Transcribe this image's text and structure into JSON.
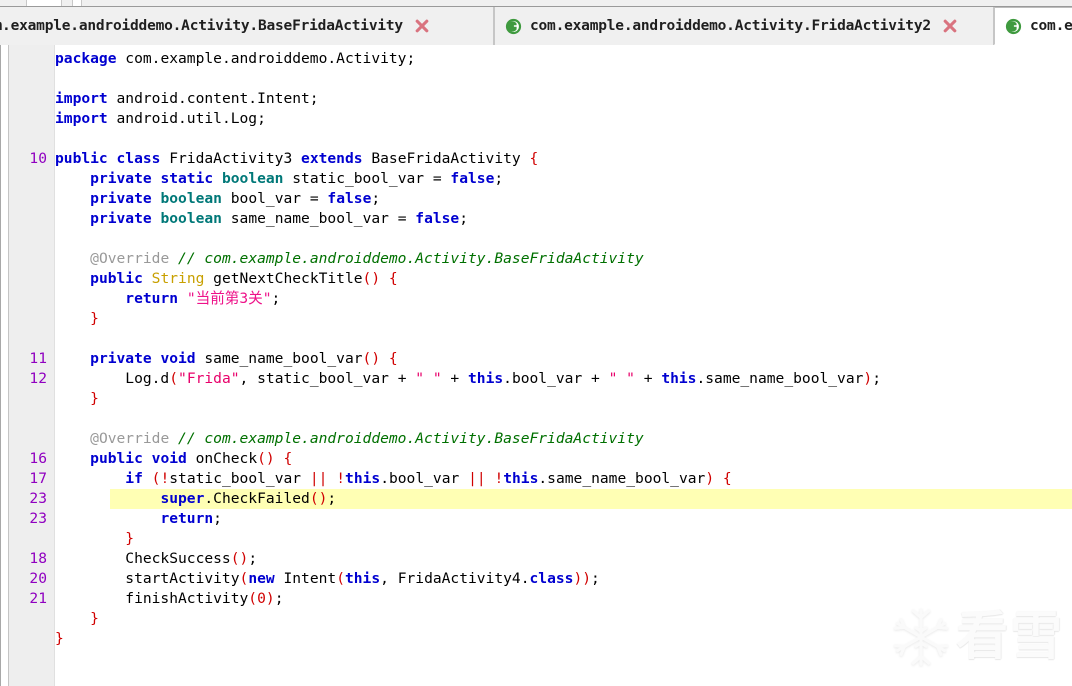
{
  "window": {
    "app": "jadx-gui",
    "theme_bg": "#ffffff",
    "gutter_bg": "#eeeeee",
    "highlight_color": "#ffffb4",
    "lineno_color": "#9000c0"
  },
  "tabs": [
    {
      "id": "tab-0",
      "label": "om.example.androiddemo.Activity.BaseFridaActivity",
      "icon": "class-icon",
      "close_icon": "close-x-icon",
      "active": false,
      "truncated_left": true
    },
    {
      "id": "tab-1",
      "label": "com.example.androiddemo.Activity.FridaActivity2",
      "icon": "class-icon",
      "close_icon": "close-x-icon",
      "active": false,
      "truncated_left": false
    },
    {
      "id": "tab-2",
      "label": "com.e",
      "icon": "class-icon",
      "close_icon": null,
      "active": true,
      "truncated_left": false
    }
  ],
  "editor": {
    "language": "java",
    "highlighted_line_index": 22,
    "lines": [
      {
        "no": "",
        "tokens": [
          {
            "c": "k",
            "t": "package"
          },
          {
            "c": "n",
            "t": " com.example.androiddemo.Activity;"
          }
        ]
      },
      {
        "no": "",
        "tokens": []
      },
      {
        "no": "",
        "tokens": [
          {
            "c": "k",
            "t": "import"
          },
          {
            "c": "n",
            "t": " android.content.Intent;"
          }
        ]
      },
      {
        "no": "",
        "tokens": [
          {
            "c": "k",
            "t": "import"
          },
          {
            "c": "n",
            "t": " android.util.Log;"
          }
        ]
      },
      {
        "no": "",
        "tokens": []
      },
      {
        "no": "10",
        "tokens": [
          {
            "c": "k",
            "t": "public class"
          },
          {
            "c": "n",
            "t": " FridaActivity3 "
          },
          {
            "c": "k",
            "t": "extends"
          },
          {
            "c": "n",
            "t": " BaseFridaActivity "
          },
          {
            "c": "p",
            "t": "{"
          }
        ]
      },
      {
        "no": "",
        "tokens": [
          {
            "c": "n",
            "t": "    "
          },
          {
            "c": "k",
            "t": "private static"
          },
          {
            "c": "n",
            "t": " "
          },
          {
            "c": "t",
            "t": "boolean"
          },
          {
            "c": "n",
            "t": " static_bool_var = "
          },
          {
            "c": "k",
            "t": "false"
          },
          {
            "c": "n",
            "t": ";"
          }
        ]
      },
      {
        "no": "",
        "tokens": [
          {
            "c": "n",
            "t": "    "
          },
          {
            "c": "k",
            "t": "private"
          },
          {
            "c": "n",
            "t": " "
          },
          {
            "c": "t",
            "t": "boolean"
          },
          {
            "c": "n",
            "t": " bool_var = "
          },
          {
            "c": "k",
            "t": "false"
          },
          {
            "c": "n",
            "t": ";"
          }
        ]
      },
      {
        "no": "",
        "tokens": [
          {
            "c": "n",
            "t": "    "
          },
          {
            "c": "k",
            "t": "private"
          },
          {
            "c": "n",
            "t": " "
          },
          {
            "c": "t",
            "t": "boolean"
          },
          {
            "c": "n",
            "t": " same_name_bool_var = "
          },
          {
            "c": "k",
            "t": "false"
          },
          {
            "c": "n",
            "t": ";"
          }
        ]
      },
      {
        "no": "",
        "tokens": []
      },
      {
        "no": "",
        "tokens": [
          {
            "c": "n",
            "t": "    "
          },
          {
            "c": "an",
            "t": "@Override"
          },
          {
            "c": "n",
            "t": " "
          },
          {
            "c": "c",
            "t": "// com.example.androiddemo.Activity.BaseFridaActivity"
          }
        ]
      },
      {
        "no": "",
        "tokens": [
          {
            "c": "n",
            "t": "    "
          },
          {
            "c": "k",
            "t": "public"
          },
          {
            "c": "n",
            "t": " "
          },
          {
            "c": "ty",
            "t": "String"
          },
          {
            "c": "n",
            "t": " getNextCheckTitle"
          },
          {
            "c": "p",
            "t": "()"
          },
          {
            "c": "n",
            "t": " "
          },
          {
            "c": "p",
            "t": "{"
          }
        ]
      },
      {
        "no": "",
        "tokens": [
          {
            "c": "n",
            "t": "        "
          },
          {
            "c": "k",
            "t": "return"
          },
          {
            "c": "n",
            "t": " "
          },
          {
            "c": "s",
            "t": "\"当前第3关\""
          },
          {
            "c": "n",
            "t": ";"
          }
        ]
      },
      {
        "no": "",
        "tokens": [
          {
            "c": "n",
            "t": "    "
          },
          {
            "c": "p",
            "t": "}"
          }
        ]
      },
      {
        "no": "",
        "tokens": []
      },
      {
        "no": "11",
        "tokens": [
          {
            "c": "n",
            "t": "    "
          },
          {
            "c": "k",
            "t": "private void"
          },
          {
            "c": "n",
            "t": " same_name_bool_var"
          },
          {
            "c": "p",
            "t": "()"
          },
          {
            "c": "n",
            "t": " "
          },
          {
            "c": "p",
            "t": "{"
          }
        ]
      },
      {
        "no": "12",
        "tokens": [
          {
            "c": "n",
            "t": "        Log.d"
          },
          {
            "c": "p",
            "t": "("
          },
          {
            "c": "str",
            "t": "\"Frida\""
          },
          {
            "c": "n",
            "t": ", static_bool_var + "
          },
          {
            "c": "str",
            "t": "\" \""
          },
          {
            "c": "n",
            "t": " + "
          },
          {
            "c": "k",
            "t": "this"
          },
          {
            "c": "n",
            "t": ".bool_var + "
          },
          {
            "c": "str",
            "t": "\" \""
          },
          {
            "c": "n",
            "t": " + "
          },
          {
            "c": "k",
            "t": "this"
          },
          {
            "c": "n",
            "t": ".same_name_bool_var"
          },
          {
            "c": "p",
            "t": ")"
          },
          {
            "c": "n",
            "t": ";"
          }
        ]
      },
      {
        "no": "",
        "tokens": [
          {
            "c": "n",
            "t": "    "
          },
          {
            "c": "p",
            "t": "}"
          }
        ]
      },
      {
        "no": "",
        "tokens": []
      },
      {
        "no": "",
        "tokens": [
          {
            "c": "n",
            "t": "    "
          },
          {
            "c": "an",
            "t": "@Override"
          },
          {
            "c": "n",
            "t": " "
          },
          {
            "c": "c",
            "t": "// com.example.androiddemo.Activity.BaseFridaActivity"
          }
        ]
      },
      {
        "no": "16",
        "tokens": [
          {
            "c": "n",
            "t": "    "
          },
          {
            "c": "k",
            "t": "public void"
          },
          {
            "c": "n",
            "t": " onCheck"
          },
          {
            "c": "p",
            "t": "()"
          },
          {
            "c": "n",
            "t": " "
          },
          {
            "c": "p",
            "t": "{"
          }
        ]
      },
      {
        "no": "17",
        "tokens": [
          {
            "c": "n",
            "t": "        "
          },
          {
            "c": "k",
            "t": "if"
          },
          {
            "c": "n",
            "t": " "
          },
          {
            "c": "p",
            "t": "("
          },
          {
            "c": "p",
            "t": "!"
          },
          {
            "c": "n",
            "t": "static_bool_var "
          },
          {
            "c": "p",
            "t": "||"
          },
          {
            "c": "n",
            "t": " "
          },
          {
            "c": "p",
            "t": "!"
          },
          {
            "c": "k",
            "t": "this"
          },
          {
            "c": "n",
            "t": ".bool_var "
          },
          {
            "c": "p",
            "t": "||"
          },
          {
            "c": "n",
            "t": " "
          },
          {
            "c": "p",
            "t": "!"
          },
          {
            "c": "k",
            "t": "this"
          },
          {
            "c": "n",
            "t": ".same_name_bool_var"
          },
          {
            "c": "p",
            "t": ")"
          },
          {
            "c": "n",
            "t": " "
          },
          {
            "c": "p",
            "t": "{"
          }
        ]
      },
      {
        "no": "23",
        "tokens": [
          {
            "c": "n",
            "t": "            "
          },
          {
            "c": "k",
            "t": "super"
          },
          {
            "c": "n",
            "t": ".CheckFailed"
          },
          {
            "c": "p",
            "t": "()"
          },
          {
            "c": "n",
            "t": ";"
          }
        ]
      },
      {
        "no": "23",
        "tokens": [
          {
            "c": "n",
            "t": "            "
          },
          {
            "c": "k",
            "t": "return"
          },
          {
            "c": "n",
            "t": ";"
          }
        ]
      },
      {
        "no": "",
        "tokens": [
          {
            "c": "n",
            "t": "        "
          },
          {
            "c": "p",
            "t": "}"
          }
        ]
      },
      {
        "no": "18",
        "tokens": [
          {
            "c": "n",
            "t": "        CheckSuccess"
          },
          {
            "c": "p",
            "t": "()"
          },
          {
            "c": "n",
            "t": ";"
          }
        ]
      },
      {
        "no": "20",
        "tokens": [
          {
            "c": "n",
            "t": "        startActivity"
          },
          {
            "c": "p",
            "t": "("
          },
          {
            "c": "k",
            "t": "new"
          },
          {
            "c": "n",
            "t": " Intent"
          },
          {
            "c": "p",
            "t": "("
          },
          {
            "c": "k",
            "t": "this"
          },
          {
            "c": "n",
            "t": ", FridaActivity4."
          },
          {
            "c": "k",
            "t": "class"
          },
          {
            "c": "p",
            "t": "))"
          },
          {
            "c": "n",
            "t": ";"
          }
        ]
      },
      {
        "no": "21",
        "tokens": [
          {
            "c": "n",
            "t": "        finishActivity"
          },
          {
            "c": "p",
            "t": "("
          },
          {
            "c": "num",
            "t": "0"
          },
          {
            "c": "p",
            "t": ")"
          },
          {
            "c": "n",
            "t": ";"
          }
        ]
      },
      {
        "no": "",
        "tokens": [
          {
            "c": "n",
            "t": "    "
          },
          {
            "c": "p",
            "t": "}"
          }
        ]
      },
      {
        "no": "",
        "tokens": [
          {
            "c": "p",
            "t": "}"
          }
        ]
      }
    ]
  },
  "watermark": {
    "icon": "snowflake-icon",
    "text": "看雪"
  }
}
